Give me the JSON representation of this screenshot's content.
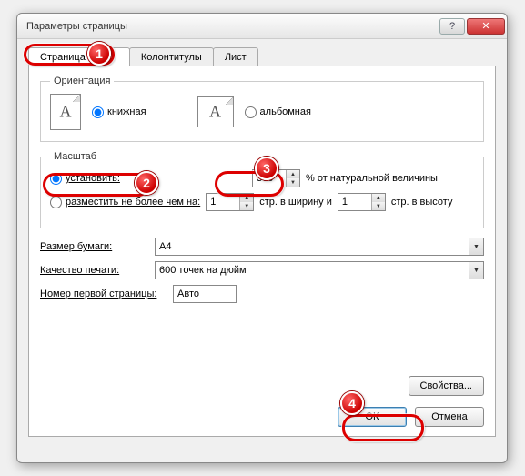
{
  "window": {
    "title": "Параметры страницы"
  },
  "tabs": {
    "page": "Страница",
    "headers": "Колонтитулы",
    "sheet": "Лист"
  },
  "orientation": {
    "legend": "Ориентация",
    "portrait": "книжная",
    "landscape": "альбомная"
  },
  "scale": {
    "legend": "Масштаб",
    "adjust": "установить:",
    "adjust_value": "300",
    "adjust_suffix": "% от натуральной величины",
    "fit": "разместить не более чем на:",
    "fit_w": "1",
    "fit_w_suffix": "стр. в ширину и",
    "fit_h": "1",
    "fit_h_suffix": "стр. в высоту"
  },
  "paper": {
    "size_label": "Размер бумаги:",
    "size_value": "A4",
    "quality_label": "Качество печати:",
    "quality_value": "600 точек на дюйм"
  },
  "firstPage": {
    "label": "Номер первой страницы:",
    "value": "Авто"
  },
  "buttons": {
    "properties": "Свойства...",
    "ok": "ОК",
    "cancel": "Отмена"
  },
  "markers": {
    "m1": "1",
    "m2": "2",
    "m3": "3",
    "m4": "4"
  }
}
